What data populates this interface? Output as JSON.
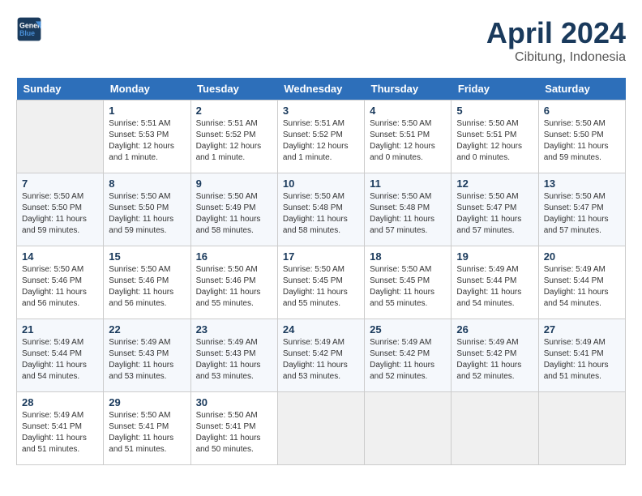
{
  "header": {
    "logo_line1": "General",
    "logo_line2": "Blue",
    "month": "April 2024",
    "location": "Cibitung, Indonesia"
  },
  "columns": [
    "Sunday",
    "Monday",
    "Tuesday",
    "Wednesday",
    "Thursday",
    "Friday",
    "Saturday"
  ],
  "weeks": [
    [
      {
        "num": "",
        "info": ""
      },
      {
        "num": "1",
        "info": "Sunrise: 5:51 AM\nSunset: 5:53 PM\nDaylight: 12 hours\nand 1 minute."
      },
      {
        "num": "2",
        "info": "Sunrise: 5:51 AM\nSunset: 5:52 PM\nDaylight: 12 hours\nand 1 minute."
      },
      {
        "num": "3",
        "info": "Sunrise: 5:51 AM\nSunset: 5:52 PM\nDaylight: 12 hours\nand 1 minute."
      },
      {
        "num": "4",
        "info": "Sunrise: 5:50 AM\nSunset: 5:51 PM\nDaylight: 12 hours\nand 0 minutes."
      },
      {
        "num": "5",
        "info": "Sunrise: 5:50 AM\nSunset: 5:51 PM\nDaylight: 12 hours\nand 0 minutes."
      },
      {
        "num": "6",
        "info": "Sunrise: 5:50 AM\nSunset: 5:50 PM\nDaylight: 11 hours\nand 59 minutes."
      }
    ],
    [
      {
        "num": "7",
        "info": "Sunrise: 5:50 AM\nSunset: 5:50 PM\nDaylight: 11 hours\nand 59 minutes."
      },
      {
        "num": "8",
        "info": "Sunrise: 5:50 AM\nSunset: 5:50 PM\nDaylight: 11 hours\nand 59 minutes."
      },
      {
        "num": "9",
        "info": "Sunrise: 5:50 AM\nSunset: 5:49 PM\nDaylight: 11 hours\nand 58 minutes."
      },
      {
        "num": "10",
        "info": "Sunrise: 5:50 AM\nSunset: 5:48 PM\nDaylight: 11 hours\nand 58 minutes."
      },
      {
        "num": "11",
        "info": "Sunrise: 5:50 AM\nSunset: 5:48 PM\nDaylight: 11 hours\nand 57 minutes."
      },
      {
        "num": "12",
        "info": "Sunrise: 5:50 AM\nSunset: 5:47 PM\nDaylight: 11 hours\nand 57 minutes."
      },
      {
        "num": "13",
        "info": "Sunrise: 5:50 AM\nSunset: 5:47 PM\nDaylight: 11 hours\nand 57 minutes."
      }
    ],
    [
      {
        "num": "14",
        "info": "Sunrise: 5:50 AM\nSunset: 5:46 PM\nDaylight: 11 hours\nand 56 minutes."
      },
      {
        "num": "15",
        "info": "Sunrise: 5:50 AM\nSunset: 5:46 PM\nDaylight: 11 hours\nand 56 minutes."
      },
      {
        "num": "16",
        "info": "Sunrise: 5:50 AM\nSunset: 5:46 PM\nDaylight: 11 hours\nand 55 minutes."
      },
      {
        "num": "17",
        "info": "Sunrise: 5:50 AM\nSunset: 5:45 PM\nDaylight: 11 hours\nand 55 minutes."
      },
      {
        "num": "18",
        "info": "Sunrise: 5:50 AM\nSunset: 5:45 PM\nDaylight: 11 hours\nand 55 minutes."
      },
      {
        "num": "19",
        "info": "Sunrise: 5:49 AM\nSunset: 5:44 PM\nDaylight: 11 hours\nand 54 minutes."
      },
      {
        "num": "20",
        "info": "Sunrise: 5:49 AM\nSunset: 5:44 PM\nDaylight: 11 hours\nand 54 minutes."
      }
    ],
    [
      {
        "num": "21",
        "info": "Sunrise: 5:49 AM\nSunset: 5:44 PM\nDaylight: 11 hours\nand 54 minutes."
      },
      {
        "num": "22",
        "info": "Sunrise: 5:49 AM\nSunset: 5:43 PM\nDaylight: 11 hours\nand 53 minutes."
      },
      {
        "num": "23",
        "info": "Sunrise: 5:49 AM\nSunset: 5:43 PM\nDaylight: 11 hours\nand 53 minutes."
      },
      {
        "num": "24",
        "info": "Sunrise: 5:49 AM\nSunset: 5:42 PM\nDaylight: 11 hours\nand 53 minutes."
      },
      {
        "num": "25",
        "info": "Sunrise: 5:49 AM\nSunset: 5:42 PM\nDaylight: 11 hours\nand 52 minutes."
      },
      {
        "num": "26",
        "info": "Sunrise: 5:49 AM\nSunset: 5:42 PM\nDaylight: 11 hours\nand 52 minutes."
      },
      {
        "num": "27",
        "info": "Sunrise: 5:49 AM\nSunset: 5:41 PM\nDaylight: 11 hours\nand 51 minutes."
      }
    ],
    [
      {
        "num": "28",
        "info": "Sunrise: 5:49 AM\nSunset: 5:41 PM\nDaylight: 11 hours\nand 51 minutes."
      },
      {
        "num": "29",
        "info": "Sunrise: 5:50 AM\nSunset: 5:41 PM\nDaylight: 11 hours\nand 51 minutes."
      },
      {
        "num": "30",
        "info": "Sunrise: 5:50 AM\nSunset: 5:41 PM\nDaylight: 11 hours\nand 50 minutes."
      },
      {
        "num": "",
        "info": ""
      },
      {
        "num": "",
        "info": ""
      },
      {
        "num": "",
        "info": ""
      },
      {
        "num": "",
        "info": ""
      }
    ]
  ]
}
